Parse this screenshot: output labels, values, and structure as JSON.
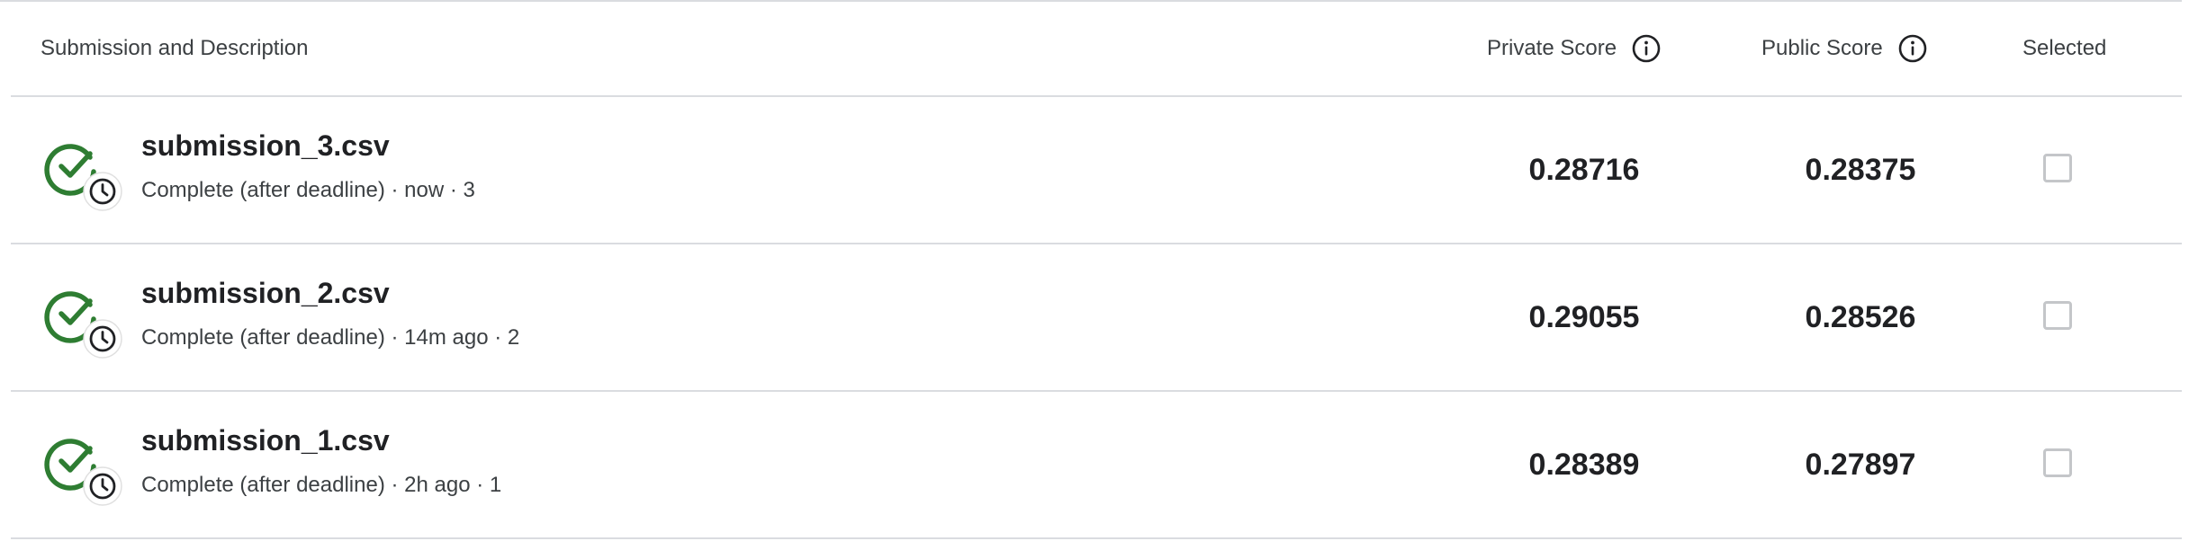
{
  "header": {
    "description_label": "Submission and Description",
    "private_score_label": "Private Score",
    "public_score_label": "Public Score",
    "selected_label": "Selected"
  },
  "colors": {
    "status_green": "#2e7d32",
    "divider": "#dadce0",
    "text_primary": "#202124",
    "text_secondary": "#3c4043"
  },
  "icons": {
    "status": "check-circle-with-clock-icon",
    "info": "info-icon"
  },
  "submissions": [
    {
      "filename": "submission_3.csv",
      "meta": "Complete (after deadline) · now · 3",
      "private_score": "0.28716",
      "public_score": "0.28375",
      "selected": false
    },
    {
      "filename": "submission_2.csv",
      "meta": "Complete (after deadline) · 14m ago · 2",
      "private_score": "0.29055",
      "public_score": "0.28526",
      "selected": false
    },
    {
      "filename": "submission_1.csv",
      "meta": "Complete (after deadline) · 2h ago · 1",
      "private_score": "0.28389",
      "public_score": "0.27897",
      "selected": false
    }
  ]
}
